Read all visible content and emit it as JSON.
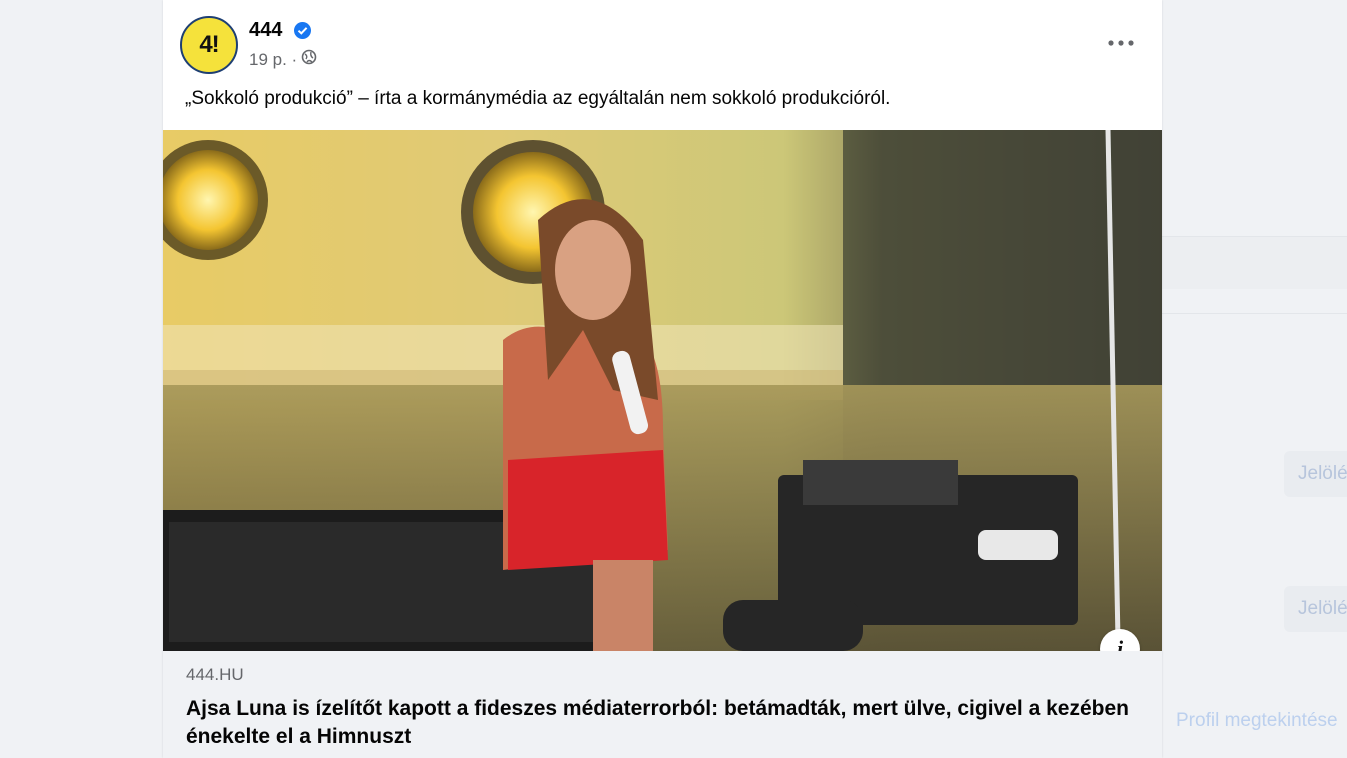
{
  "post": {
    "page_name": "444",
    "avatar_text": "4!",
    "time": "19 p. ·",
    "caption": "„Sokkoló produkció” – írta a kormánymédia az egyáltalán nem sokkoló produkcióról.",
    "more_icon": "ellipsis-icon",
    "privacy_icon": "globe-icon",
    "verified_icon": "verified-badge-icon",
    "info_label": "i"
  },
  "link": {
    "domain": "444.HU",
    "headline": "Ajsa Luna is ízelítőt kapott a fideszes médiaterrorból: betámadták, mert ülve, cigivel a kezében énekelte el a Himnuszt"
  },
  "right_panel": {
    "button_1": "Jelölés",
    "button_2": "Jelölés",
    "link": "Profil megtekintése"
  },
  "colors": {
    "accent": "#1877f2",
    "avatar_bg": "#f5e23b",
    "background": "#f0f2f5"
  }
}
